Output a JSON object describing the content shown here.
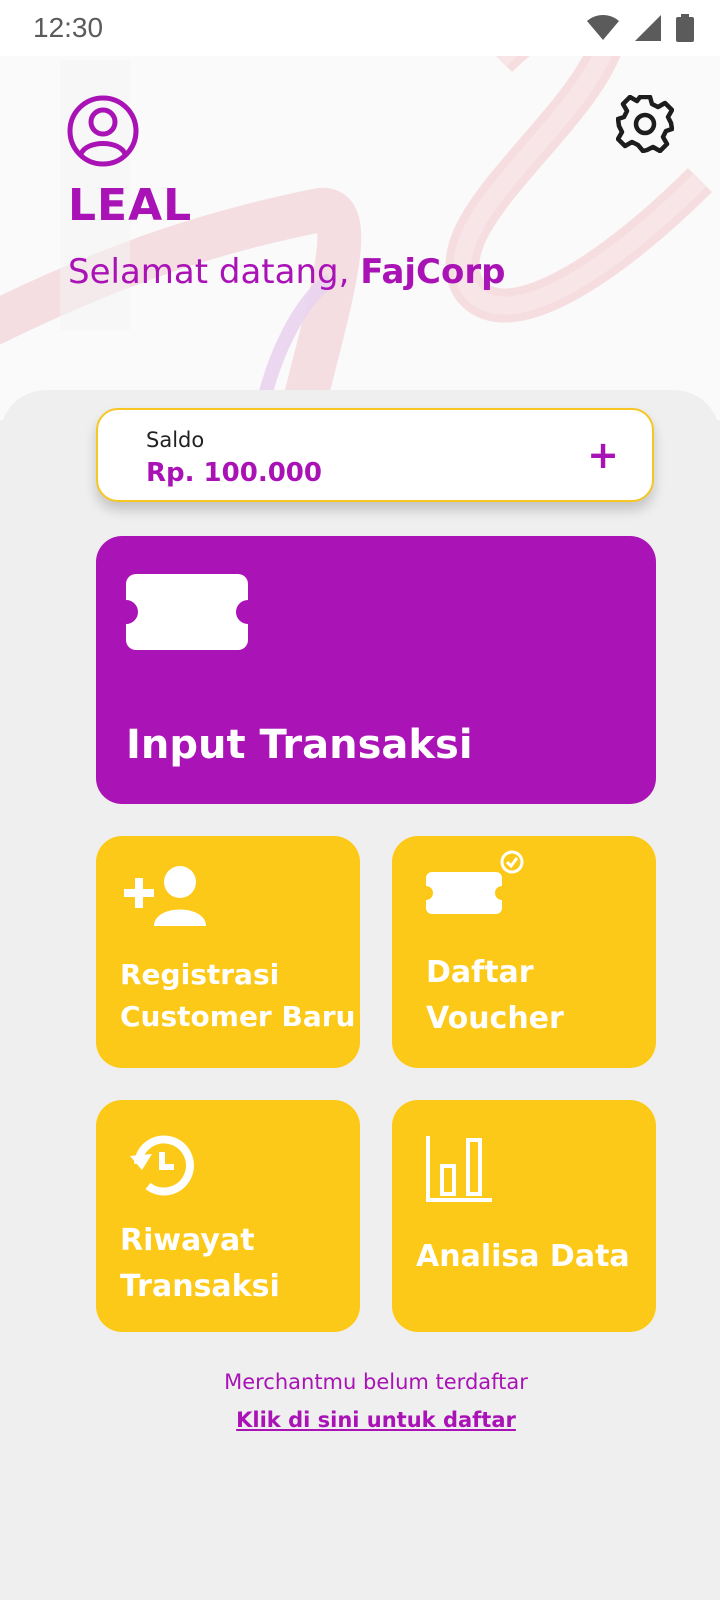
{
  "status_bar": {
    "time": "12:30",
    "icons": [
      "wifi-icon",
      "signal-icon",
      "battery-icon"
    ]
  },
  "header": {
    "brand": "LEAL",
    "greeting_prefix": "Selamat datang,",
    "user_name": "FajCorp",
    "profile_icon": "user-circle-icon",
    "settings_icon": "gear-icon"
  },
  "balance": {
    "label": "Saldo",
    "value": "Rp. 100.000",
    "add_icon": "+"
  },
  "actions": {
    "primary": {
      "label": "Input Transaksi",
      "icon": "ticket-icon"
    },
    "registration": {
      "line1": "Registrasi",
      "line2": "Customer Baru",
      "icon": "add-user-icon"
    },
    "vouchers": {
      "line1": "Daftar",
      "line2": "Voucher",
      "icon": "ticket-check-icon"
    },
    "history": {
      "line1": "Riwayat",
      "line2": "Transaksi",
      "icon": "history-icon"
    },
    "analysis": {
      "label": "Analisa Data",
      "icon": "bar-chart-icon"
    }
  },
  "footer": {
    "note": "Merchantmu belum terdaftar",
    "link": "Klik di sini untuk daftar"
  },
  "colors": {
    "primary_purple": "#a913b6",
    "accent_yellow": "#fdc918",
    "background": "#efefef"
  }
}
